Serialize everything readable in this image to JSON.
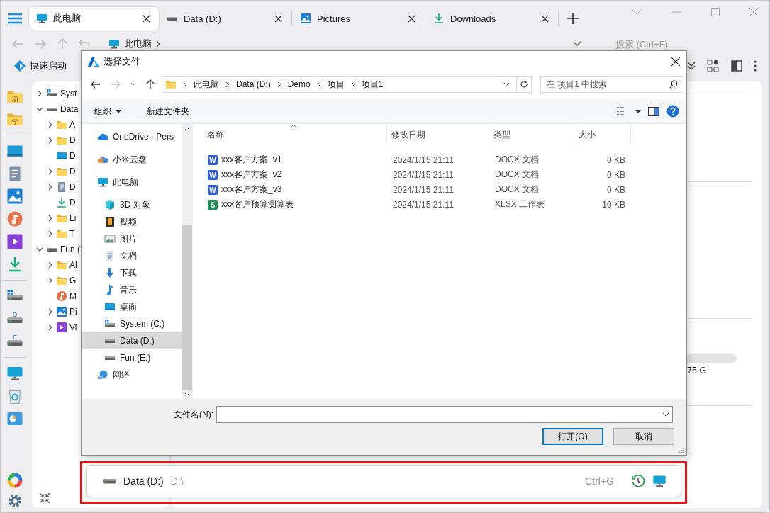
{
  "tabs": [
    {
      "label": "此电脑",
      "selected": true
    },
    {
      "label": "Data (D:)",
      "selected": false
    },
    {
      "label": "Pictures",
      "selected": false
    },
    {
      "label": "Downloads",
      "selected": false
    }
  ],
  "toolbar": {
    "breadcrumb": [
      "此电脑"
    ],
    "search": {
      "placeholder": "搜索 (Ctrl+F)"
    },
    "quick_launch": "快速启动"
  },
  "rail": [
    {
      "items": [
        {
          "kind": "folder",
          "letter": "项"
        },
        {
          "kind": "folder",
          "letter": "学"
        }
      ]
    },
    {
      "items": [
        {
          "kind": "desktop"
        },
        {
          "kind": "doc"
        },
        {
          "kind": "pictures"
        },
        {
          "kind": "music"
        },
        {
          "kind": "video"
        },
        {
          "kind": "download"
        }
      ]
    },
    {
      "items": [
        {
          "kind": "drivewin"
        },
        {
          "kind": "driveletter",
          "letter": "D"
        },
        {
          "kind": "driveletter",
          "letter": "E"
        }
      ]
    },
    {
      "items": [
        {
          "kind": "pc"
        },
        {
          "kind": "recycle"
        },
        {
          "kind": "control"
        }
      ]
    }
  ],
  "tree": [
    {
      "label": "Syst",
      "kind": "drivewin",
      "expanded": false
    },
    {
      "label": "Data",
      "kind": "drive",
      "expanded": true,
      "children": [
        {
          "label": "A",
          "kind": "folder",
          "expanded": false
        },
        {
          "label": "D",
          "kind": "folder",
          "expanded": false
        },
        {
          "label": "D",
          "kind": "desktop"
        },
        {
          "label": "D",
          "kind": "folder",
          "expanded": false
        },
        {
          "label": "D",
          "kind": "doc",
          "expanded": false
        },
        {
          "label": "D",
          "kind": "download"
        },
        {
          "label": "Li",
          "kind": "folder",
          "expanded": false
        },
        {
          "label": "T",
          "kind": "folder",
          "expanded": false
        }
      ]
    },
    {
      "label": "Fun (",
      "kind": "drive",
      "expanded": true,
      "children": [
        {
          "label": "Al",
          "kind": "folder",
          "expanded": false
        },
        {
          "label": "G",
          "kind": "folder",
          "expanded": false
        },
        {
          "label": "M",
          "kind": "music"
        },
        {
          "label": "Pi",
          "kind": "pictures",
          "expanded": false
        },
        {
          "label": "Vi",
          "kind": "video",
          "expanded": false
        }
      ]
    }
  ],
  "main_panel": {
    "capacity": "75 G"
  },
  "dialog": {
    "title": "选择文件",
    "path": [
      "此电脑",
      "Data (D:)",
      "Demo",
      "项目",
      "项目1"
    ],
    "search": {
      "placeholder": "在 项目1 中搜索"
    },
    "commands": [
      {
        "label": "组织",
        "menu": true
      },
      {
        "label": "新建文件夹",
        "menu": false
      }
    ],
    "nav": [
      {
        "label": "OneDrive - Pers",
        "kind": "onedrive",
        "selected": false
      },
      {
        "label": "小米云盘",
        "kind": "mi",
        "selected": false
      },
      {
        "label": "此电脑",
        "kind": "pc",
        "selected": false,
        "children": [
          {
            "label": "3D 对象",
            "kind": "cube",
            "selected": false
          },
          {
            "label": "视频",
            "kind": "film",
            "selected": false
          },
          {
            "label": "图片",
            "kind": "photo",
            "selected": false
          },
          {
            "label": "文档",
            "kind": "page",
            "selected": false
          },
          {
            "label": "下载",
            "kind": "downarrow",
            "selected": false
          },
          {
            "label": "音乐",
            "kind": "note",
            "selected": false
          },
          {
            "label": "桌面",
            "kind": "desktop",
            "selected": false
          },
          {
            "label": "System (C:)",
            "kind": "drivewin",
            "selected": false
          },
          {
            "label": "Data (D:)",
            "kind": "drive",
            "selected": true
          },
          {
            "label": "Fun (E:)",
            "kind": "drive",
            "selected": false
          }
        ]
      },
      {
        "label": "网络",
        "kind": "network",
        "selected": false
      }
    ],
    "columns": [
      "名称",
      "修改日期",
      "类型",
      "大小"
    ],
    "rows": [
      {
        "kind": "word",
        "letter": "W",
        "name": "xxx客户方案_v1",
        "date": "2024/1/15 21:11",
        "type": "DOCX 文档",
        "size": "0 KB"
      },
      {
        "kind": "word",
        "letter": "W",
        "name": "xxx客户方案_v2",
        "date": "2024/1/15 21:11",
        "type": "DOCX 文档",
        "size": "0 KB"
      },
      {
        "kind": "word",
        "letter": "W",
        "name": "xxx客户方案_v3",
        "date": "2024/1/15 21:11",
        "type": "DOCX 文档",
        "size": "0 KB"
      },
      {
        "kind": "sheet",
        "letter": "S",
        "name": "xxx客户预算测算表",
        "date": "2024/1/15 21:11",
        "type": "XLSX 工作表",
        "size": "10 KB"
      }
    ],
    "filename": {
      "label": "文件名(N):"
    },
    "buttons": [
      {
        "label": "打开(O)",
        "default": true
      },
      {
        "label": "取消",
        "default": false
      }
    ]
  },
  "quick_bar": {
    "drive": "Data (D:)",
    "path": "D:\\",
    "shortcut": "Ctrl+G"
  }
}
